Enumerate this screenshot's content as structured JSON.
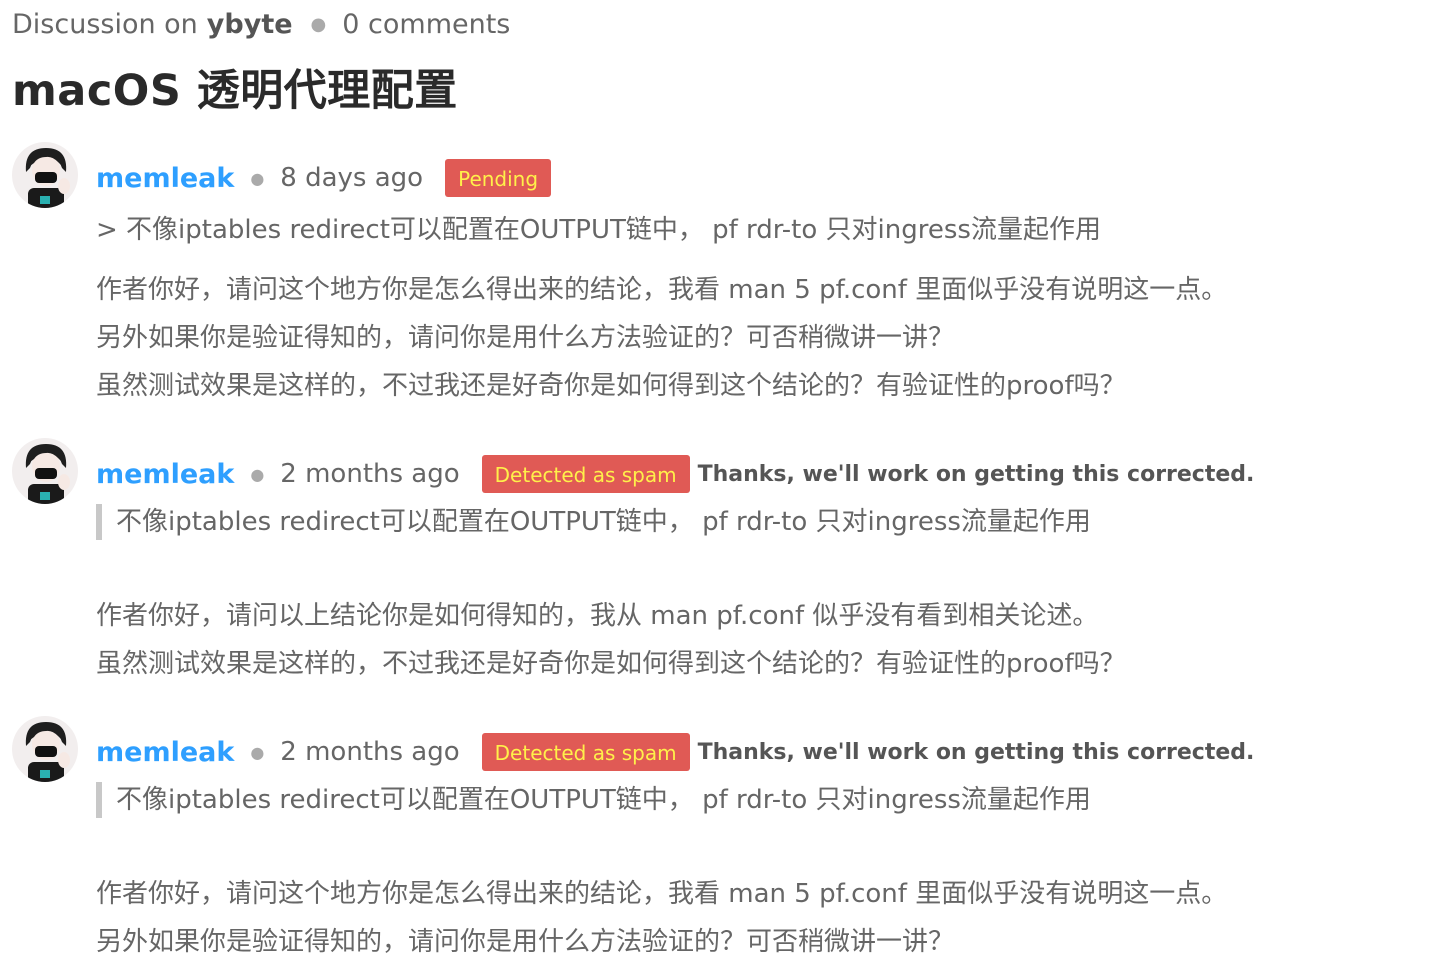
{
  "header": {
    "prefix": "Discussion on",
    "site": "ybyte",
    "comment_count": "0 comments"
  },
  "page_title": "macOS 透明代理配置",
  "colors": {
    "author_link": "#2e9fff",
    "badge_bg": "#e05a55",
    "badge_text": "#fff04a"
  },
  "comments": [
    {
      "author": "memleak",
      "time": "8 days ago",
      "badge": "Pending",
      "note": "",
      "quote": "> 不像iptables redirect可以配置在OUTPUT链中， pf rdr-to 只对ingress流量起作用",
      "lines": [
        "作者你好，请问这个地方你是怎么得出来的结论，我看 man 5 pf.conf 里面似乎没有说明这一点。",
        "另外如果你是验证得知的，请问你是用什么方法验证的？可否稍微讲一讲？",
        "虽然测试效果是这样的，不过我还是好奇你是如何得到这个结论的？有验证性的proof吗？"
      ]
    },
    {
      "author": "memleak",
      "time": "2 months ago",
      "badge": "Detected as spam",
      "note": "Thanks, we'll work on getting this corrected.",
      "quote": "不像iptables redirect可以配置在OUTPUT链中， pf rdr-to 只对ingress流量起作用",
      "lines": [
        "作者你好，请问以上结论你是如何得知的，我从 man pf.conf 似乎没有看到相关论述。",
        "虽然测试效果是这样的，不过我还是好奇你是如何得到这个结论的？有验证性的proof吗？"
      ]
    },
    {
      "author": "memleak",
      "time": "2 months ago",
      "badge": "Detected as spam",
      "note": "Thanks, we'll work on getting this corrected.",
      "quote": "不像iptables redirect可以配置在OUTPUT链中， pf rdr-to 只对ingress流量起作用",
      "lines": [
        "作者你好，请问这个地方你是怎么得出来的结论，我看 man 5 pf.conf 里面似乎没有说明这一点。",
        "另外如果你是验证得知的，请问你是用什么方法验证的？可否稍微讲一讲？"
      ]
    }
  ]
}
